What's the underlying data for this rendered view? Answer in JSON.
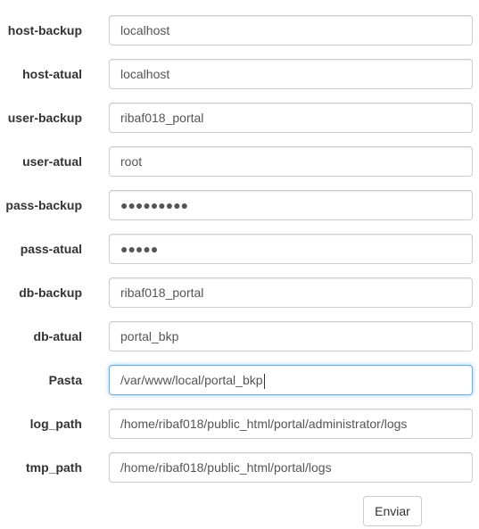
{
  "form": {
    "fields": [
      {
        "label": "host-backup",
        "value": "localhost"
      },
      {
        "label": "host-atual",
        "value": "localhost"
      },
      {
        "label": "user-backup",
        "value": "ribaf018_portal"
      },
      {
        "label": "user-atual",
        "value": "root"
      },
      {
        "label": "pass-backup",
        "value": "●●●●●●●●●"
      },
      {
        "label": "pass-atual",
        "value": "●●●●●"
      },
      {
        "label": "db-backup",
        "value": "ribaf018_portal"
      },
      {
        "label": "db-atual",
        "value": "portal_bkp"
      },
      {
        "label": "Pasta",
        "value": "/var/www/local/portal_bkp"
      },
      {
        "label": "log_path",
        "value": "/home/ribaf018/public_html/portal/administrator/logs"
      },
      {
        "label": "tmp_path",
        "value": "/home/ribaf018/public_html/portal/logs"
      }
    ],
    "submit_label": "Enviar"
  }
}
